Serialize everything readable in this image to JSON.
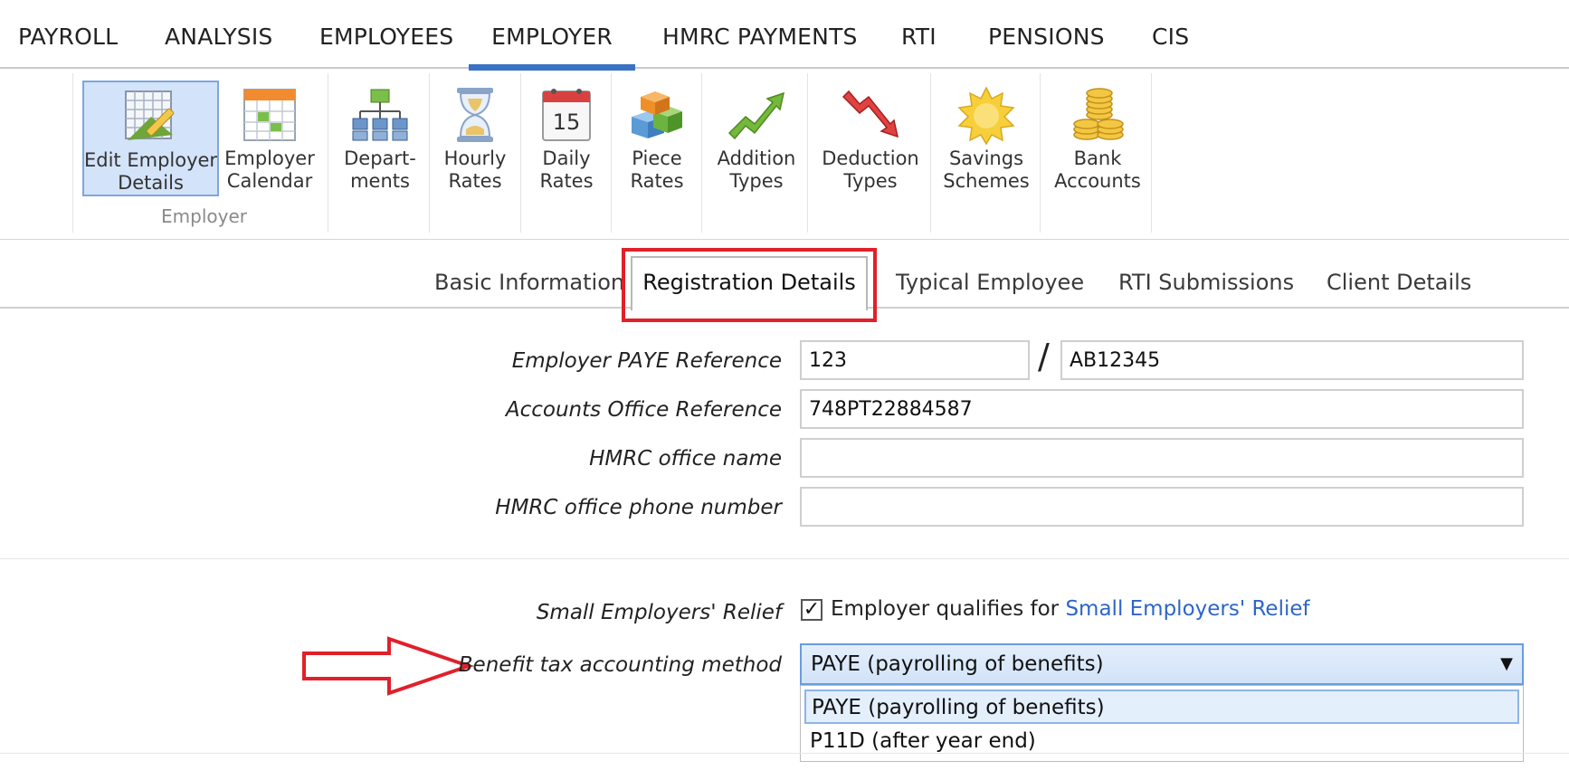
{
  "menu": {
    "items": [
      "PAYROLL",
      "ANALYSIS",
      "EMPLOYEES",
      "EMPLOYER",
      "HMRC PAYMENTS",
      "RTI",
      "PENSIONS",
      "CIS"
    ],
    "active": "EMPLOYER"
  },
  "ribbon": {
    "buttons": [
      {
        "line1": "Edit Employer",
        "line2": "Details",
        "icon": "edit-grid-icon"
      },
      {
        "line1": "Employer",
        "line2": "Calendar",
        "icon": "calendar-grid-icon"
      },
      {
        "line1": "Depart-",
        "line2": "ments",
        "icon": "org-chart-icon"
      },
      {
        "line1": "Hourly",
        "line2": "Rates",
        "icon": "hourglass-icon"
      },
      {
        "line1": "Daily",
        "line2": "Rates",
        "icon": "calendar-day-icon"
      },
      {
        "line1": "Piece",
        "line2": "Rates",
        "icon": "blocks-icon"
      },
      {
        "line1": "Addition",
        "line2": "Types",
        "icon": "trend-up-icon"
      },
      {
        "line1": "Deduction",
        "line2": "Types",
        "icon": "trend-down-icon"
      },
      {
        "line1": "Savings",
        "line2": "Schemes",
        "icon": "sun-badge-icon"
      },
      {
        "line1": "Bank",
        "line2": "Accounts",
        "icon": "coins-icon"
      }
    ],
    "calendar_day": "15",
    "group_label": "Employer"
  },
  "tabs": [
    "Basic Information",
    "Registration Details",
    "Typical Employee",
    "RTI Submissions",
    "Client Details"
  ],
  "active_tab": "Registration Details",
  "form": {
    "paye_label": "Employer PAYE Reference",
    "paye_part1": "123",
    "paye_sep": "/",
    "paye_part2": "AB12345",
    "accounts_label": "Accounts Office Reference",
    "accounts_value": "748PT22884587",
    "office_name_label": "HMRC office name",
    "office_name_value": "",
    "office_phone_label": "HMRC office phone number",
    "office_phone_value": "",
    "ser_label": "Small Employers' Relief",
    "ser_checked": true,
    "ser_text": "Employer qualifies for",
    "ser_link": "Small Employers' Relief",
    "benefit_label": "Benefit tax accounting method",
    "benefit_selected": "PAYE (payrolling of benefits)",
    "benefit_options": [
      "PAYE (payrolling of benefits)",
      "P11D (after year end)"
    ]
  },
  "colors": {
    "accent": "#3b73c4",
    "annotation_red": "#e0202a",
    "link": "#2e66c7",
    "selected_bg": "#d3e3f9"
  }
}
